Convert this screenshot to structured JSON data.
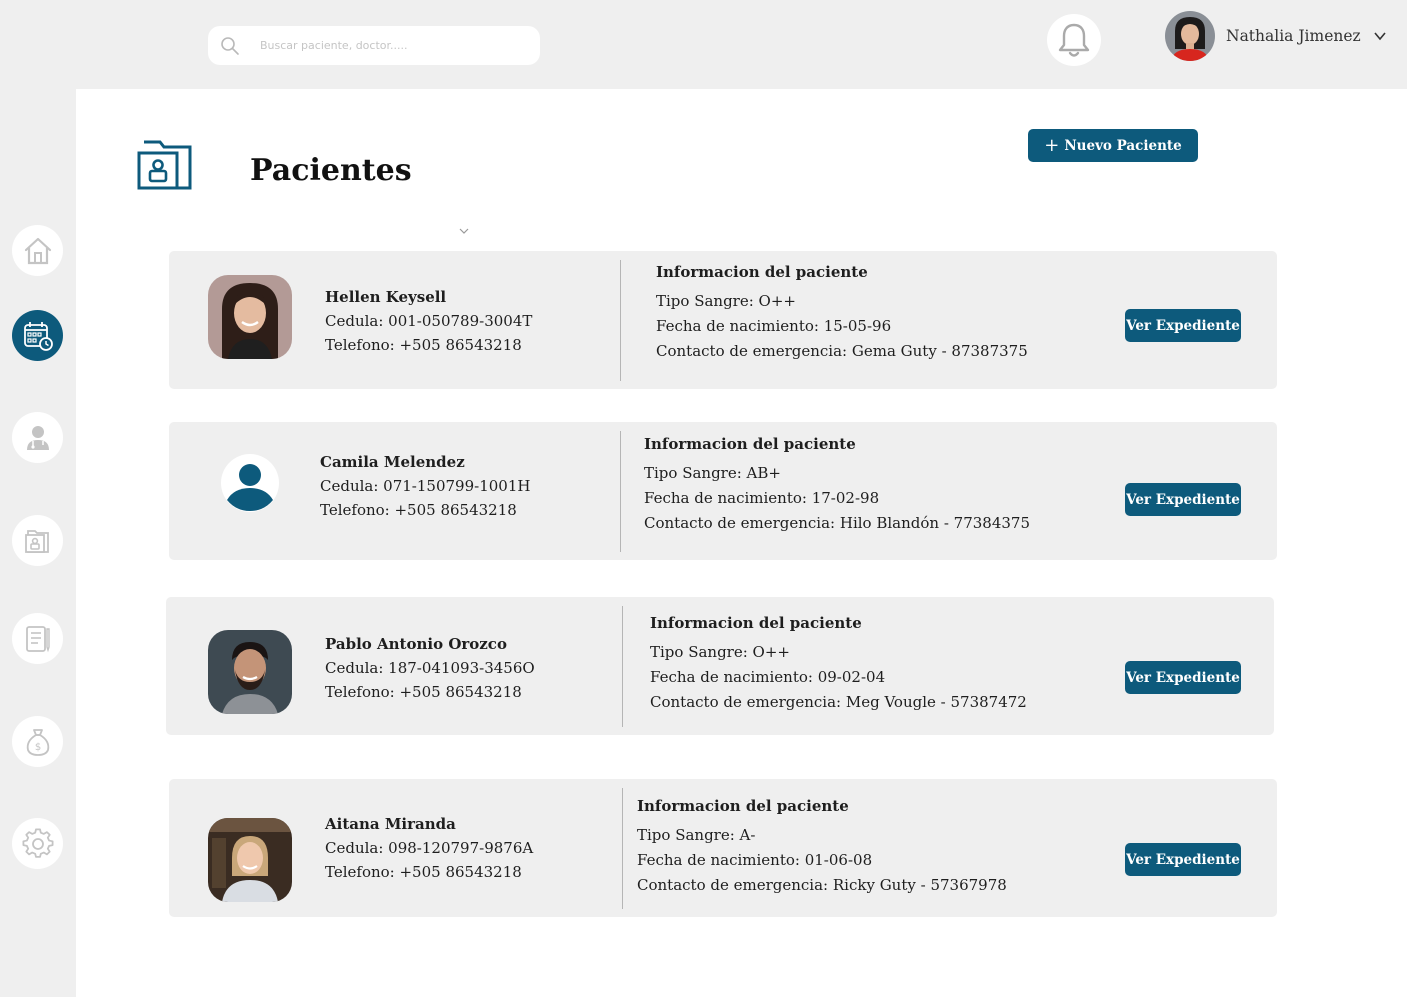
{
  "search": {
    "placeholder": "Buscar paciente, doctor....."
  },
  "user": {
    "name": "Nathalia Jimenez"
  },
  "sidebar": {
    "items": [
      {
        "icon": "home-icon",
        "active": false
      },
      {
        "icon": "calendar-clock-icon",
        "active": true
      },
      {
        "icon": "doctor-icon",
        "active": false
      },
      {
        "icon": "patient-folder-icon",
        "active": false
      },
      {
        "icon": "records-icon",
        "active": false
      },
      {
        "icon": "money-bag-icon",
        "active": false
      },
      {
        "icon": "gear-icon",
        "active": false
      }
    ]
  },
  "page": {
    "title": "Pacientes",
    "new_button": "Nuevo Paciente"
  },
  "colors": {
    "primary": "#0d5a7c",
    "card_bg": "#efefef",
    "sidebar_bg": "#efefef"
  },
  "patients": [
    {
      "name": "Hellen Keysell",
      "cedula": "Cedula: 001-050789-3004T",
      "telefono": "Telefono: +505 86543218",
      "info_title": "Informacion del paciente",
      "blood": "Tipo Sangre: O++",
      "birth": "Fecha de nacimiento: 15-05-96",
      "emergency": "Contacto de emergencia: Gema Guty - 87387375",
      "button": "Ver Expediente"
    },
    {
      "name": "Camila Melendez",
      "cedula": "Cedula: 071-150799-1001H",
      "telefono": "Telefono: +505 86543218",
      "info_title": "Informacion del paciente",
      "blood": "Tipo Sangre: AB+",
      "birth": "Fecha de nacimiento: 17-02-98",
      "emergency": "Contacto de emergencia: Hilo Blandón - 77384375",
      "button": "Ver Expediente"
    },
    {
      "name": "Pablo Antonio Orozco",
      "cedula": "Cedula: 187-041093-3456O",
      "telefono": "Telefono: +505 86543218",
      "info_title": "Informacion del paciente",
      "blood": "Tipo Sangre: O++",
      "birth": "Fecha de nacimiento: 09-02-04",
      "emergency": "Contacto de emergencia: Meg Vougle - 57387472",
      "button": "Ver Expediente"
    },
    {
      "name": "Aitana Miranda",
      "cedula": "Cedula: 098-120797-9876A",
      "telefono": "Telefono: +505 86543218",
      "info_title": "Informacion del paciente",
      "blood": "Tipo Sangre: A-",
      "birth": "Fecha de nacimiento: 01-06-08",
      "emergency": "Contacto de emergencia: Ricky Guty - 57367978",
      "button": "Ver Expediente"
    }
  ]
}
